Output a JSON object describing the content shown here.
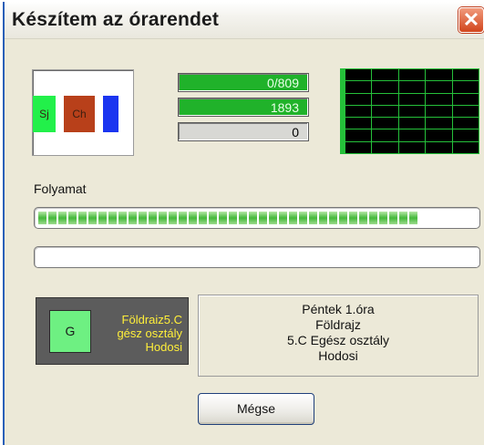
{
  "window": {
    "title": "Készítem az órarendet",
    "close_glyph": "✕"
  },
  "preview": {
    "cells": [
      {
        "label": "Sj",
        "color": "#22f04a"
      },
      {
        "label": "Ch",
        "color": "#b8401a"
      },
      {
        "label": "",
        "color": "#1b35f0"
      }
    ]
  },
  "counters": {
    "first": "0/809",
    "second": "1893",
    "third": "0"
  },
  "progress": {
    "label": "Folyamat",
    "main_fraction": 0.88,
    "second_fraction": 0.0
  },
  "lesson_tile": {
    "letter": "G",
    "line1": "Földraiz5.C",
    "line2": "gész osztály",
    "line3": "Hodosi"
  },
  "lesson_info": {
    "line1": "Péntek 1.óra",
    "line2": "Földrajz",
    "line3": "5.C Egész osztály",
    "line4": "Hodosi"
  },
  "buttons": {
    "cancel": "Mégse"
  },
  "colors": {
    "accent_green": "#20b22a",
    "grid_green": "#25c03a",
    "tile_text": "#ffef3a"
  }
}
